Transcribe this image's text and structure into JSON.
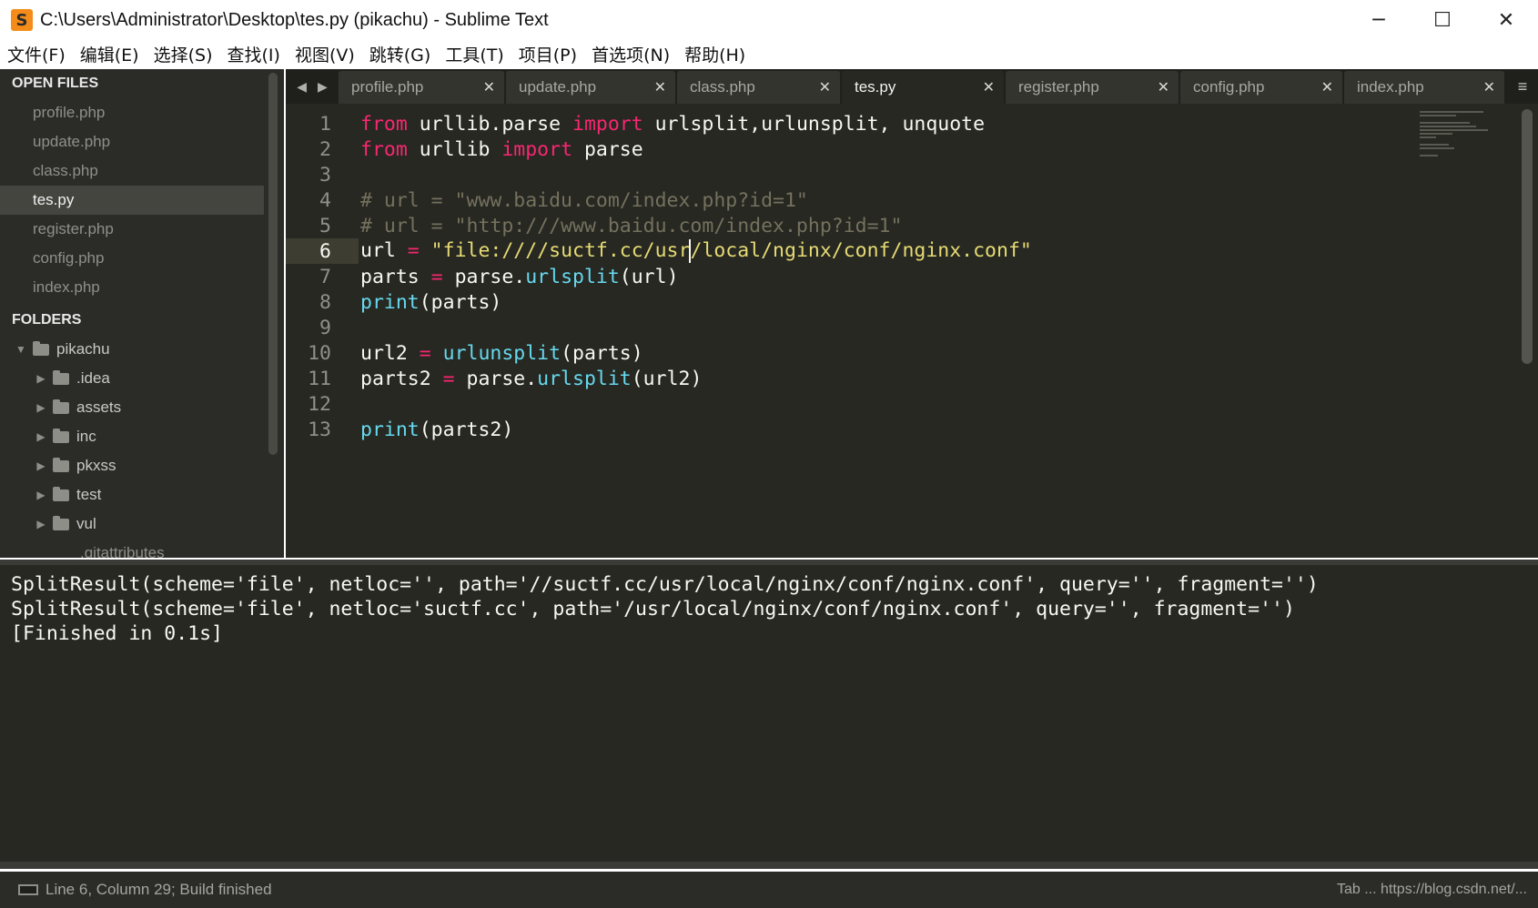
{
  "window": {
    "title": "C:\\Users\\Administrator\\Desktop\\tes.py (pikachu) - Sublime Text",
    "app_icon": "sublime-text-icon",
    "controls": {
      "minimize": "─",
      "maximize": "☐",
      "close": "✕"
    }
  },
  "menu": [
    "文件(F)",
    "编辑(E)",
    "选择(S)",
    "查找(I)",
    "视图(V)",
    "跳转(G)",
    "工具(T)",
    "项目(P)",
    "首选项(N)",
    "帮助(H)"
  ],
  "sidebar": {
    "open_files_header": "OPEN FILES",
    "open_files": [
      "profile.php",
      "update.php",
      "class.php",
      "tes.py",
      "register.php",
      "config.php",
      "index.php"
    ],
    "active_file": "tes.py",
    "folders_header": "FOLDERS",
    "root_folder": "pikachu",
    "subfolders": [
      ".idea",
      "assets",
      "inc",
      "pkxss",
      "test",
      "vul"
    ],
    "files": [
      ".gitattributes"
    ]
  },
  "tabs": [
    {
      "label": "profile.php",
      "active": false
    },
    {
      "label": "update.php",
      "active": false
    },
    {
      "label": "class.php",
      "active": false
    },
    {
      "label": "tes.py",
      "active": true
    },
    {
      "label": "register.php",
      "active": false
    },
    {
      "label": "config.php",
      "active": false
    },
    {
      "label": "index.php",
      "active": false
    }
  ],
  "editor": {
    "current_line": 6,
    "line_numbers": [
      "1",
      "2",
      "3",
      "4",
      "5",
      "6",
      "7",
      "8",
      "9",
      "10",
      "11",
      "12",
      "13"
    ],
    "lines": [
      "from urllib.parse import urlsplit,urlunsplit, unquote",
      "from urllib import parse",
      "",
      "# url = \"www.baidu.com/index.php?id=1\"",
      "# url = \"http:///www.baidu.com/index.php?id=1\"",
      "url = \"file:////suctf.cc/usr/local/nginx/conf/nginx.conf\"",
      "parts = parse.urlsplit(url)",
      "print(parts)",
      "",
      "url2 = urlunsplit(parts)",
      "parts2 = parse.urlsplit(url2)",
      "",
      "print(parts2)"
    ],
    "tokens": {
      "l1": {
        "kw1": "from",
        "t1": " urllib.parse ",
        "kw2": "import",
        "t2": " urlsplit,urlunsplit, unquote"
      },
      "l2": {
        "kw1": "from",
        "t1": " urllib ",
        "kw2": "import",
        "t2": " parse"
      },
      "l4": "# url = \"www.baidu.com/index.php?id=1\"",
      "l5": "# url = \"http:///www.baidu.com/index.php?id=1\"",
      "l6": {
        "var": "url ",
        "op": "=",
        "str_a": " \"file:////suctf.cc/usr",
        "str_b": "/local/nginx/conf/nginx.conf\""
      },
      "l7": {
        "var": "parts ",
        "op": "=",
        "t1": " parse.",
        "fn": "urlsplit",
        "t2": "(url)"
      },
      "l8": {
        "fn": "print",
        "t": "(parts)"
      },
      "l10": {
        "var": "url2 ",
        "op": "=",
        "fn": " urlunsplit",
        "t": "(parts)"
      },
      "l11": {
        "var": "parts2 ",
        "op": "=",
        "t1": " parse.",
        "fn": "urlsplit",
        "t2": "(url2)"
      },
      "l13": {
        "fn": "print",
        "t": "(parts2)"
      }
    }
  },
  "output": [
    "SplitResult(scheme='file', netloc='', path='//suctf.cc/usr/local/nginx/conf/nginx.conf', query='', fragment='')",
    "SplitResult(scheme='file', netloc='suctf.cc', path='/usr/local/nginx/conf/nginx.conf', query='', fragment='')",
    "[Finished in 0.1s]"
  ],
  "status": {
    "left": "Line 6, Column 29; Build finished",
    "right": "Tab ... https://blog.csdn.net/..."
  },
  "colors": {
    "editor_bg": "#272822",
    "keyword": "#f92672",
    "function": "#66d9ef",
    "string": "#e6db74",
    "comment": "#75715e",
    "sidebar_bg": "#2b2b28"
  }
}
